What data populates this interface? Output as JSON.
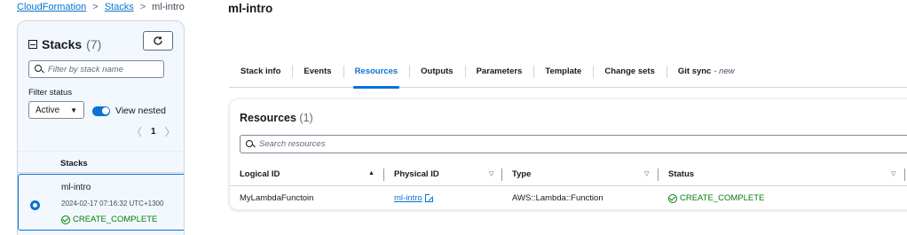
{
  "breadcrumb": {
    "items": [
      "CloudFormation",
      "Stacks",
      "ml-intro"
    ],
    "separator": ">"
  },
  "stacks_panel": {
    "title": "Stacks",
    "count": "(7)",
    "refresh_icon": "refresh-icon",
    "filter_placeholder": "Filter by stack name",
    "filter_status_label": "Filter status",
    "status_select_value": "Active",
    "view_nested_label": "View nested",
    "view_nested_on": true,
    "page": "1",
    "list_header": "Stacks",
    "stacks": [
      {
        "name": "ml-intro",
        "timestamp": "2024-02-17 07:16:32 UTC+1300",
        "status": "CREATE_COMPLETE",
        "selected": true
      }
    ]
  },
  "main": {
    "title": "ml-intro",
    "tabs": [
      {
        "label": "Stack info"
      },
      {
        "label": "Events"
      },
      {
        "label": "Resources",
        "active": true
      },
      {
        "label": "Outputs"
      },
      {
        "label": "Parameters"
      },
      {
        "label": "Template"
      },
      {
        "label": "Change sets"
      },
      {
        "label": "Git sync",
        "suffix": "- new"
      }
    ],
    "resources": {
      "title": "Resources",
      "count": "(1)",
      "search_placeholder": "Search resources",
      "columns": [
        "Logical ID",
        "Physical ID",
        "Type",
        "Status"
      ],
      "rows": [
        {
          "logical_id": "MyLambdaFunctoin",
          "physical_id": "ml-intro",
          "type": "AWS::Lambda::Function",
          "status": "CREATE_COMPLETE"
        }
      ]
    }
  },
  "colors": {
    "accent": "#0972d3",
    "success": "#037f0c",
    "panel_bg": "#f2f8fd"
  }
}
